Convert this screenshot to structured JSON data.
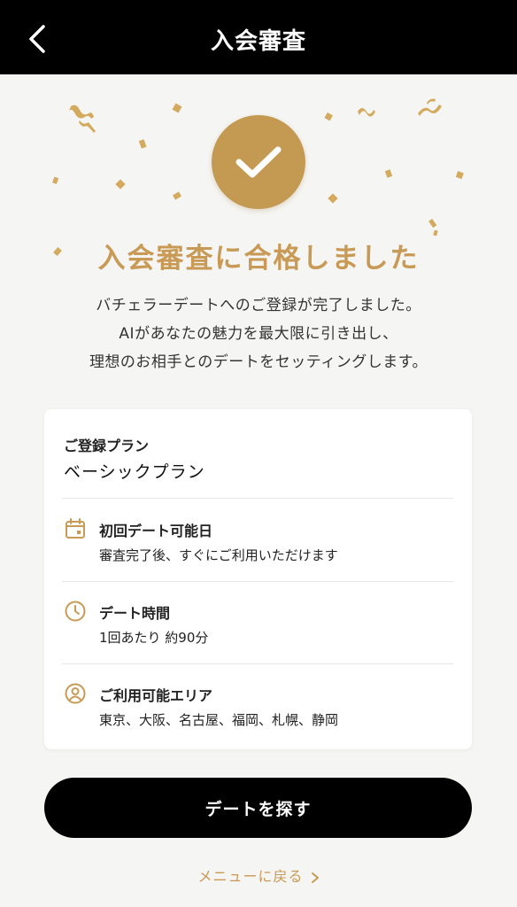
{
  "header": {
    "title": "入会審査"
  },
  "success": {
    "title": "入会審査に合格しました",
    "description": [
      "バチェラーデートへのご登録が完了しました。",
      "AIがあなたの魅力を最大限に引き出し、",
      "理想のお相手とのデートをセッティングします。"
    ]
  },
  "plan": {
    "label": "ご登録プラン",
    "value": "ベーシックプラン"
  },
  "details": [
    {
      "icon": "calendar-icon",
      "title": "初回デート可能日",
      "value": "審査完了後、すぐにご利用いただけます"
    },
    {
      "icon": "clock-icon",
      "title": "デート時間",
      "value": "1回あたり 約90分"
    },
    {
      "icon": "user-circle-icon",
      "title": "ご利用可能エリア",
      "value": "東京、大阪、名古屋、福岡、札幌、静岡"
    }
  ],
  "actions": {
    "primary_label": "デートを探す",
    "menu_link_label": "メニューに戻る"
  },
  "colors": {
    "accent_gold": "#c89a55",
    "header_bg": "#000000",
    "page_bg": "#f5f5f3"
  }
}
